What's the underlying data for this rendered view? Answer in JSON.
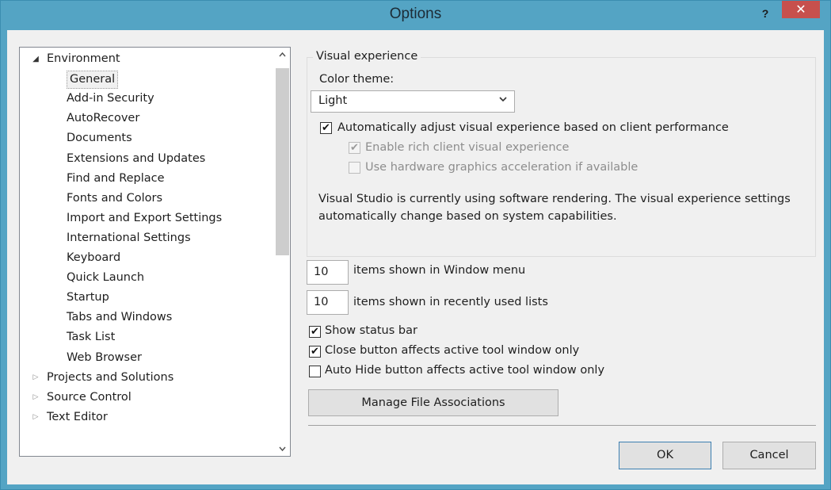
{
  "window": {
    "title": "Options",
    "help_label": "?",
    "close_label": "✕"
  },
  "tree": {
    "items": [
      {
        "label": "Environment",
        "level": 0,
        "state": "expanded"
      },
      {
        "label": "General",
        "level": 1,
        "selected": true
      },
      {
        "label": "Add-in Security",
        "level": 1
      },
      {
        "label": "AutoRecover",
        "level": 1
      },
      {
        "label": "Documents",
        "level": 1
      },
      {
        "label": "Extensions and Updates",
        "level": 1
      },
      {
        "label": "Find and Replace",
        "level": 1
      },
      {
        "label": "Fonts and Colors",
        "level": 1
      },
      {
        "label": "Import and Export Settings",
        "level": 1
      },
      {
        "label": "International Settings",
        "level": 1
      },
      {
        "label": "Keyboard",
        "level": 1
      },
      {
        "label": "Quick Launch",
        "level": 1
      },
      {
        "label": "Startup",
        "level": 1
      },
      {
        "label": "Tabs and Windows",
        "level": 1
      },
      {
        "label": "Task List",
        "level": 1
      },
      {
        "label": "Web Browser",
        "level": 1
      },
      {
        "label": "Projects and Solutions",
        "level": 0,
        "state": "collapsed"
      },
      {
        "label": "Source Control",
        "level": 0,
        "state": "collapsed"
      },
      {
        "label": "Text Editor",
        "level": 0,
        "state": "collapsed"
      }
    ],
    "scroll_up": "^",
    "scroll_down": "v"
  },
  "visual": {
    "group_title": "Visual experience",
    "color_theme_label": "Color theme:",
    "color_theme_value": "Light",
    "auto_adjust_label": "Automatically adjust visual experience based on client performance",
    "auto_adjust_checked": true,
    "rich_client_label": "Enable rich client visual experience",
    "rich_client_checked": true,
    "hw_accel_label": "Use hardware graphics acceleration if available",
    "hw_accel_checked": false,
    "info_line1": "Visual Studio is currently using software rendering.  The visual experience settings",
    "info_line2": "automatically change based on system capabilities."
  },
  "window_menu": {
    "value": "10",
    "label": "items shown in Window menu"
  },
  "recent_lists": {
    "value": "10",
    "label": "items shown in recently used lists"
  },
  "options": {
    "status_bar_label": "Show status bar",
    "status_bar_checked": true,
    "close_button_label": "Close button affects active tool window only",
    "close_button_checked": true,
    "auto_hide_label": "Auto Hide button affects active tool window only",
    "auto_hide_checked": false
  },
  "buttons": {
    "manage_label": "Manage File Associations",
    "ok_label": "OK",
    "cancel_label": "Cancel"
  },
  "glyphs": {
    "check": "✔",
    "chevron_down": "⌄",
    "expanded": "◢",
    "collapsed": "▷"
  }
}
